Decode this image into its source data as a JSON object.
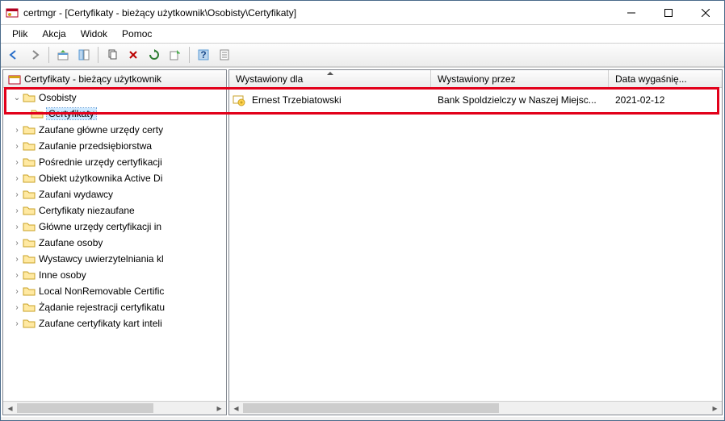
{
  "window": {
    "title": "certmgr - [Certyfikaty - bieżący użytkownik\\Osobisty\\Certyfikaty]"
  },
  "menu": {
    "file": "Plik",
    "action": "Akcja",
    "view": "Widok",
    "help": "Pomoc"
  },
  "tree": {
    "root": "Certyfikaty - bieżący użytkownik",
    "items": [
      {
        "label": "Osobisty",
        "expanded": true,
        "children": [
          {
            "label": "Certyfikaty"
          }
        ]
      },
      {
        "label": "Zaufane główne urzędy certy"
      },
      {
        "label": "Zaufanie przedsiębiorstwa"
      },
      {
        "label": "Pośrednie urzędy certyfikacji"
      },
      {
        "label": "Obiekt użytkownika Active Di"
      },
      {
        "label": "Zaufani wydawcy"
      },
      {
        "label": "Certyfikaty niezaufane"
      },
      {
        "label": "Główne urzędy certyfikacji in"
      },
      {
        "label": "Zaufane osoby"
      },
      {
        "label": "Wystawcy uwierzytelniania kl"
      },
      {
        "label": "Inne osoby"
      },
      {
        "label": "Local NonRemovable Certific"
      },
      {
        "label": "Żądanie rejestracji certyfikatu"
      },
      {
        "label": "Zaufane certyfikaty kart inteli"
      }
    ]
  },
  "list": {
    "columns": {
      "issued_to": "Wystawiony dla",
      "issued_by": "Wystawiony przez",
      "expires": "Data wygaśnię..."
    },
    "rows": [
      {
        "issued_to": "Ernest Trzebiatowski",
        "issued_by": "Bank Spoldzielczy w Naszej Miejsc...",
        "expires": "2021-02-12"
      }
    ]
  }
}
